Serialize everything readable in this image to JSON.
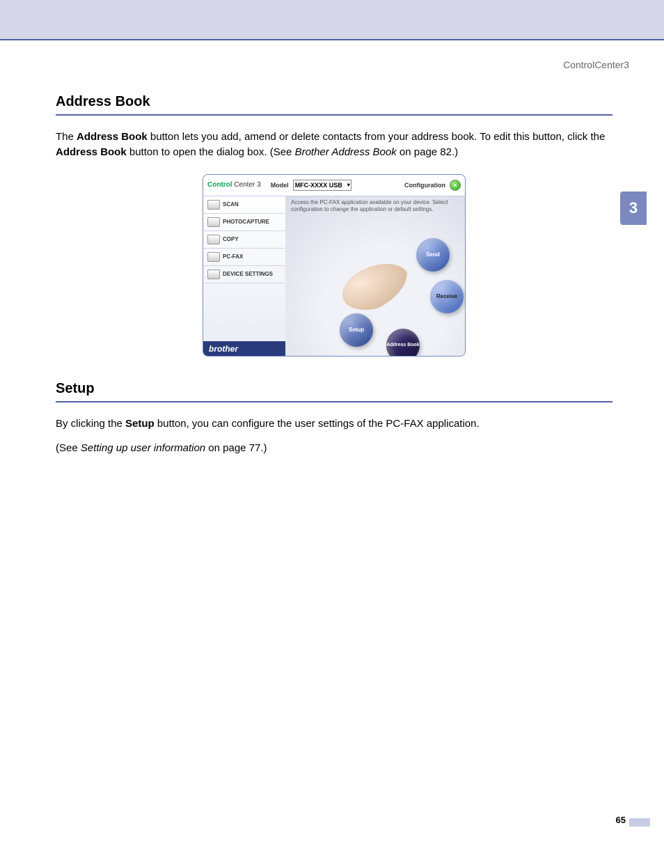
{
  "header_right": "ControlCenter3",
  "chapter_tab": "3",
  "page_number": "65",
  "sections": {
    "address_book": {
      "title": "Address Book",
      "para_pre": "The ",
      "para_b1": "Address Book",
      "para_mid1": " button lets you add, amend or delete contacts from your address book. To edit this button, click the ",
      "para_b2": "Address Book",
      "para_mid2": " button to open the dialog box. (See ",
      "para_i": "Brother Address Book",
      "para_post": " on page 82.)"
    },
    "setup": {
      "title": "Setup",
      "p1_pre": "By clicking the ",
      "p1_b": "Setup",
      "p1_post": " button, you can configure the user settings of the PC-FAX application.",
      "p2_pre": "(See ",
      "p2_i": "Setting up user information",
      "p2_post": " on page 77.)"
    }
  },
  "figure": {
    "logo": {
      "bold": "Control",
      "light": " Center 3"
    },
    "model_label": "Model",
    "model_value": "MFC-XXXX USB",
    "config_label": "Configuration",
    "nav": [
      "SCAN",
      "PHOTOCAPTURE",
      "COPY",
      "PC-FAX",
      "DEVICE SETTINGS"
    ],
    "brand": "brother",
    "desc": "Access the PC-FAX application available on your device. Select configuration to change the application or default settings.",
    "orbs": {
      "send": "Send",
      "receive": "Receive",
      "setup": "Setup",
      "address_book": "Address Book"
    }
  }
}
